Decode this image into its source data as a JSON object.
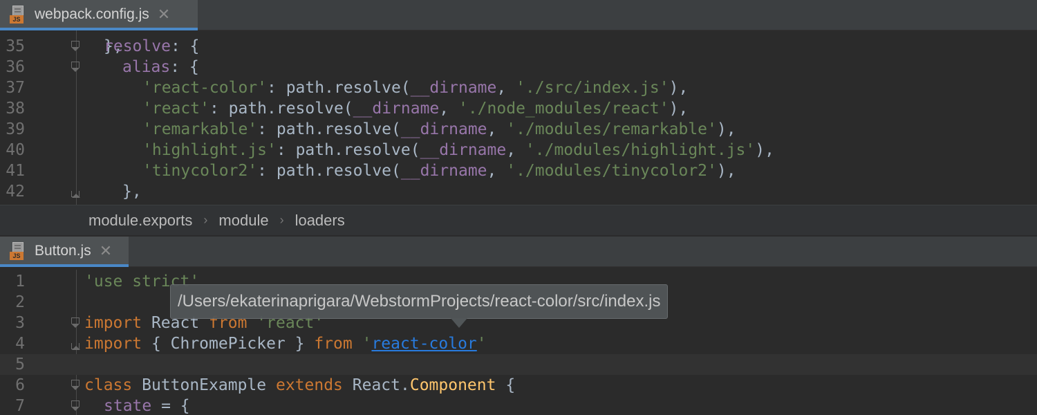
{
  "top_pane": {
    "tab": {
      "icon_badge": "JS",
      "label": "webpack.config.js",
      "close": "✕"
    },
    "lines": [
      {
        "num": "35",
        "parts": [
          [
            "prop",
            "resolve"
          ],
          [
            "",
            ": {"
          ]
        ]
      },
      {
        "num": "36",
        "parts": [
          [
            "prop",
            "alias"
          ],
          [
            "",
            ": {"
          ]
        ]
      },
      {
        "num": "37",
        "parts": [
          [
            "str",
            "'react-color'"
          ],
          [
            "",
            ": path.resolve("
          ],
          [
            "prop",
            "__dirname"
          ],
          [
            "",
            ", "
          ],
          [
            "str",
            "'./src/index.js'"
          ],
          [
            "",
            "),"
          ]
        ]
      },
      {
        "num": "38",
        "parts": [
          [
            "str",
            "'react'"
          ],
          [
            "",
            ": path.resolve("
          ],
          [
            "prop",
            "__dirname"
          ],
          [
            "",
            ", "
          ],
          [
            "str",
            "'./node_modules/react'"
          ],
          [
            "",
            "),"
          ]
        ]
      },
      {
        "num": "39",
        "parts": [
          [
            "str",
            "'remarkable'"
          ],
          [
            "",
            ": path.resolve("
          ],
          [
            "prop",
            "__dirname"
          ],
          [
            "",
            ", "
          ],
          [
            "str",
            "'./modules/remarkable'"
          ],
          [
            "",
            "),"
          ]
        ]
      },
      {
        "num": "40",
        "parts": [
          [
            "str",
            "'highlight.js'"
          ],
          [
            "",
            ": path.resolve("
          ],
          [
            "prop",
            "__dirname"
          ],
          [
            "",
            ", "
          ],
          [
            "str",
            "'./modules/highlight.js'"
          ],
          [
            "",
            "),"
          ]
        ]
      },
      {
        "num": "41",
        "parts": [
          [
            "str",
            "'tinycolor2'"
          ],
          [
            "",
            ": path.resolve("
          ],
          [
            "prop",
            "__dirname"
          ],
          [
            "",
            ", "
          ],
          [
            "str",
            "'./modules/tinycolor2'"
          ],
          [
            "",
            "),"
          ]
        ]
      },
      {
        "num": "42",
        "parts": [
          [
            "",
            "},"
          ]
        ]
      }
    ]
  },
  "breadcrumb": {
    "items": [
      "module.exports",
      "module",
      "loaders"
    ],
    "separator": "›"
  },
  "bottom_pane": {
    "tab": {
      "icon_badge": "JS",
      "label": "Button.js",
      "close": "✕"
    },
    "lines": [
      {
        "num": "1",
        "parts": [
          [
            "str",
            "'use strict'"
          ]
        ]
      },
      {
        "num": "2",
        "parts": []
      },
      {
        "num": "3",
        "parts": [
          [
            "kw",
            "import"
          ],
          [
            "",
            " React "
          ],
          [
            "kw",
            "from"
          ],
          [
            "",
            " "
          ],
          [
            "str",
            "'react'"
          ]
        ]
      },
      {
        "num": "4",
        "parts": [
          [
            "kw",
            "import"
          ],
          [
            "",
            " { ChromePicker } "
          ],
          [
            "kw",
            "from"
          ],
          [
            "",
            " "
          ],
          [
            "str",
            "'"
          ],
          [
            "link",
            "react-color"
          ],
          [
            "str",
            "'"
          ]
        ]
      },
      {
        "num": "5",
        "parts": []
      },
      {
        "num": "6",
        "parts": [
          [
            "kw",
            "class"
          ],
          [
            "",
            " ButtonExample "
          ],
          [
            "kw",
            "extends"
          ],
          [
            "",
            " React."
          ],
          [
            "fn",
            "Component"
          ],
          [
            "",
            " {"
          ]
        ]
      },
      {
        "num": "7",
        "parts": [
          [
            "prop",
            "state"
          ],
          [
            "",
            " = {"
          ]
        ]
      }
    ]
  },
  "tooltip": {
    "text": "/Users/ekaterinaprigara/WebstormProjects/react-color/src/index.js"
  },
  "colors": {
    "background": "#2b2b2b",
    "keyword": "#cc7832",
    "string": "#6a8759",
    "property": "#9876aa",
    "function": "#ffc66d",
    "link": "#287bde",
    "tab_accent": "#4a88c7"
  }
}
